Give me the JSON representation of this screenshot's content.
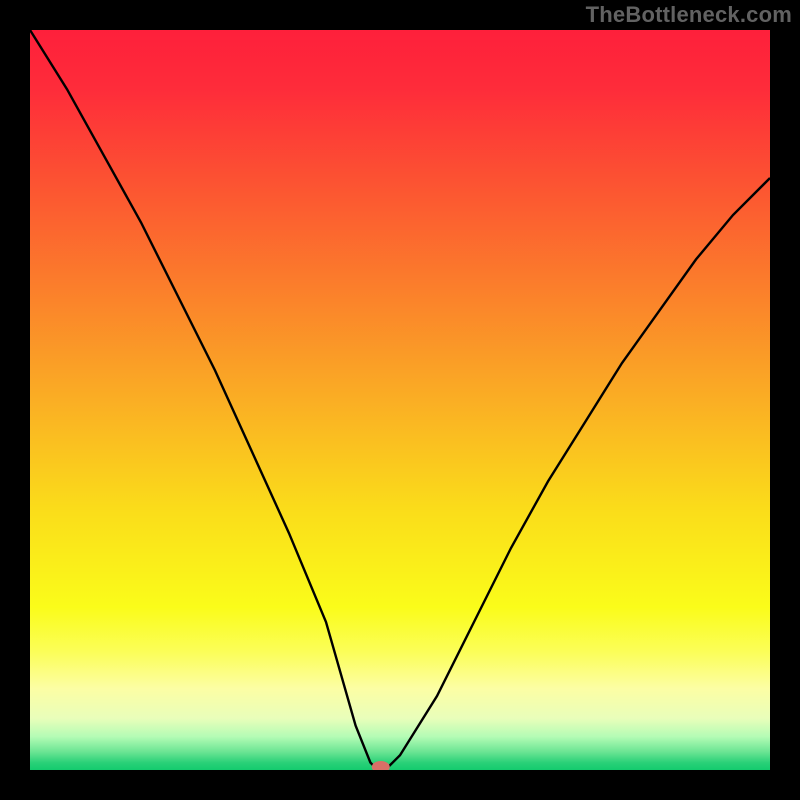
{
  "watermark": "TheBottleneck.com",
  "chart_data": {
    "type": "line",
    "title": "",
    "xlabel": "",
    "ylabel": "",
    "xlim": [
      0,
      100
    ],
    "ylim": [
      0,
      100
    ],
    "x": [
      0,
      5,
      10,
      15,
      20,
      25,
      30,
      35,
      40,
      44,
      46,
      47,
      48,
      50,
      55,
      60,
      65,
      70,
      75,
      80,
      85,
      90,
      95,
      100
    ],
    "y": [
      100,
      92,
      83,
      74,
      64,
      54,
      43,
      32,
      20,
      6,
      1,
      0,
      0,
      2,
      10,
      20,
      30,
      39,
      47,
      55,
      62,
      69,
      75,
      80
    ],
    "gradient_stops": [
      {
        "pos": 0.0,
        "color": "#fe203b"
      },
      {
        "pos": 0.08,
        "color": "#fe2c3a"
      },
      {
        "pos": 0.2,
        "color": "#fc5132"
      },
      {
        "pos": 0.35,
        "color": "#fb7f2b"
      },
      {
        "pos": 0.5,
        "color": "#faae24"
      },
      {
        "pos": 0.65,
        "color": "#fadd1a"
      },
      {
        "pos": 0.78,
        "color": "#fafc1a"
      },
      {
        "pos": 0.84,
        "color": "#fbfe58"
      },
      {
        "pos": 0.89,
        "color": "#fcfea4"
      },
      {
        "pos": 0.93,
        "color": "#e9feba"
      },
      {
        "pos": 0.955,
        "color": "#b4fcb5"
      },
      {
        "pos": 0.975,
        "color": "#6de594"
      },
      {
        "pos": 0.99,
        "color": "#2ad178"
      },
      {
        "pos": 1.0,
        "color": "#13cb6e"
      }
    ],
    "marker": {
      "x": 47.4,
      "y": 0.4,
      "color": "#d77067"
    }
  }
}
